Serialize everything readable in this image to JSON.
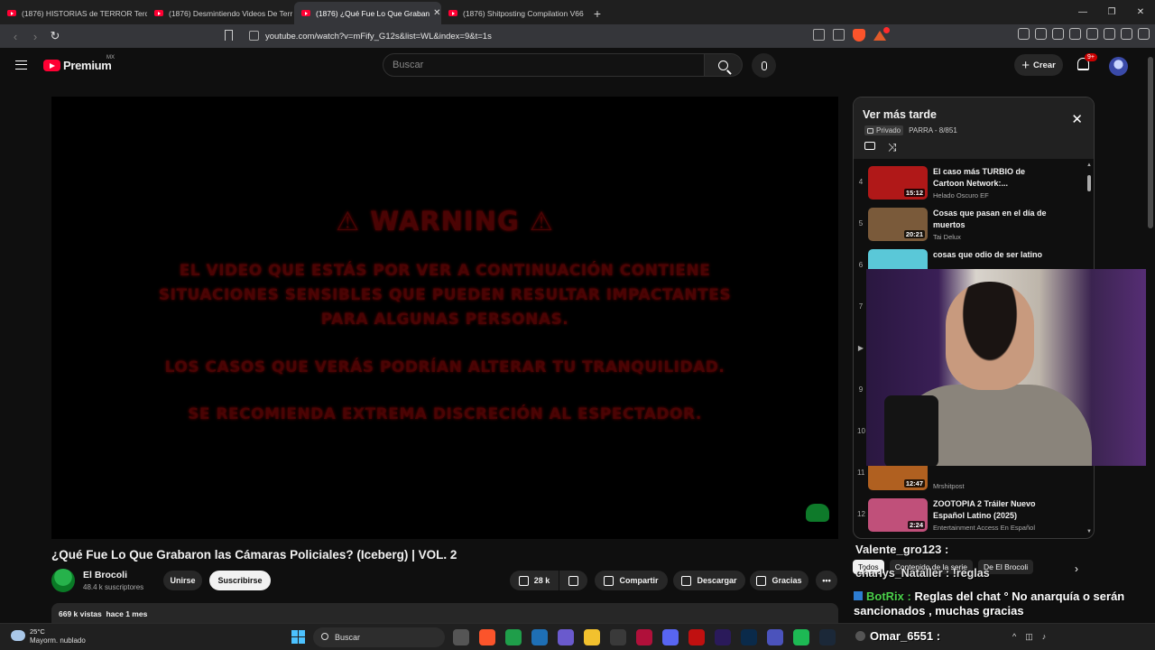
{
  "browser": {
    "tabs": [
      {
        "title": "(1876) HISTORIAS de TERROR Tercer"
      },
      {
        "title": "(1876) Desmintiendo Videos De Terr"
      },
      {
        "title": "(1876) ¿Qué Fue Lo Que Graban"
      },
      {
        "title": "(1876) Shitposting Compilation V66"
      }
    ],
    "url": "youtube.com/watch?v=mFify_G12s&list=WL&index=9&t=1s",
    "brand_color": "#ff0033"
  },
  "yt": {
    "logo_text": "Premium",
    "region": "MX",
    "search_placeholder": "Buscar",
    "create_label": "Crear",
    "notifications_badge": "9+"
  },
  "video": {
    "warning_title": "⚠ WARNING ⚠",
    "warning_lines": [
      "EL VIDEO QUE ESTÁS POR VER A CONTINUACIÓN CONTIENE",
      "SITUACIONES SENSIBLES QUE PUEDEN RESULTAR IMPACTANTES",
      "PARA ALGUNAS PERSONAS.",
      "LOS CASOS QUE VERÁS PODRÍAN ALTERAR TU TRANQUILIDAD.",
      "SE RECOMIENDA EXTREMA DISCRECIÓN AL ESPECTADOR."
    ],
    "title": "¿Qué Fue Lo Que Grabaron las Cámaras Policiales? (Iceberg) | VOL. 2",
    "channel": "El Brocoli",
    "subscribers": "48.4 k suscriptores",
    "join_label": "Unirse",
    "subscribe_label": "Suscribirse",
    "likes": "28 k",
    "share_label": "Compartir",
    "download_label": "Descargar",
    "thanks_label": "Gracias",
    "views": "669 k vistas",
    "age": "hace 1 mes"
  },
  "playlist": {
    "title": "Ver más tarde",
    "privacy": "Privado",
    "meta": "PARRA - 8/851",
    "items": [
      {
        "index": "4",
        "title": "El caso más TURBIO de Cartoon Network:...",
        "channel": "Helado Oscuro EF",
        "duration": "15:12",
        "thumb": "#b01818"
      },
      {
        "index": "5",
        "title": "Cosas que pasan en el día de muertos",
        "channel": "Tai Delux",
        "duration": "20:21",
        "thumb": "#7a5a3a"
      },
      {
        "index": "6",
        "title": "cosas que odio de ser latino",
        "channel": "",
        "duration": "",
        "thumb": "#5ac8d8"
      },
      {
        "index": "7",
        "title": "",
        "channel": "",
        "duration": "",
        "thumb": "#b04020"
      },
      {
        "index": "▶",
        "title": "",
        "channel": "",
        "duration": "",
        "thumb": "#555555"
      },
      {
        "index": "9",
        "title": "",
        "channel": "",
        "duration": "",
        "thumb": "#c06030"
      },
      {
        "index": "10",
        "title": "",
        "channel": "",
        "duration": "",
        "thumb": "#2a6ab0"
      },
      {
        "index": "11",
        "title": "",
        "channel": "Mrshitpost",
        "duration": "12:47",
        "thumb": "#b06020"
      },
      {
        "index": "12",
        "title": "ZOOTOPIA 2 Tráiler Nuevo Español Latino (2025)",
        "channel": "Entertainment Access En Español",
        "duration": "2:24",
        "thumb": "#c0507a"
      }
    ]
  },
  "chat": {
    "user1": "Valente_gro123 :",
    "chips": [
      "Todos",
      "Contenido de la serie",
      "De El Brocoli"
    ],
    "user2": "charlys_Nataller : !reglas",
    "bot_name": "BotRix :",
    "bot_message": "Reglas del chat ° No anarquía o serán sancionados , muchas gracias",
    "user3": "Omar_6551 :"
  },
  "taskbar": {
    "temperature": "25°C",
    "weather": "Mayorm. nublado",
    "search_label": "Buscar"
  }
}
